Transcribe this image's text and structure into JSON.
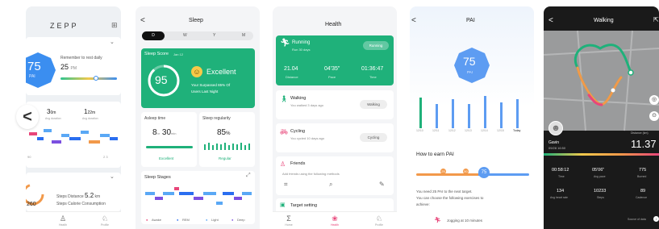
{
  "p1": {
    "logo": "ZEPP",
    "pai_value": "75",
    "pai_unit": "PAI",
    "remind_text": "Remember to rest daily",
    "rest_value": "25",
    "rest_unit": "PM",
    "back_arrow": "<",
    "time_a": "3",
    "time_a_unit": "0m",
    "time_a_label": "Avg duration",
    "time_b": "1",
    "time_b_unit": "22m",
    "time_b_label": "Avg duration",
    "day_label": "90",
    "day_label2": "2 3",
    "steps_value": "260",
    "distance_label": "Steps Distance",
    "distance_value": "5.2",
    "distance_unit": "km",
    "calories_label": "Steps Calorie Consumption",
    "tab1_label": "Health",
    "tab2_label": "Profile"
  },
  "p2": {
    "back": "<",
    "title": "Sleep",
    "tabs": [
      "D",
      "W",
      "Y",
      "M"
    ],
    "score_label": "Sleep Score",
    "score_date": "Jan 12",
    "score_value": "95",
    "score_word": "Excellent",
    "score_desc_1": "Your Surpassed 85% Of",
    "score_desc_2": "Users Last Night",
    "asleep_label": "Asleep time",
    "asleep_h": "8",
    "asleep_h_unit": "hr",
    "asleep_m": "30",
    "asleep_m_unit": "min",
    "asleep_status": "Excellent",
    "regularity_label": "Sleep regularity",
    "regularity_value": "85",
    "regularity_unit": "%",
    "regularity_status": "Regular",
    "stages_label": "Sleep Stages",
    "legend": [
      "Awake",
      "REM",
      "Light",
      "Deep"
    ],
    "colors": {
      "green": "#1fb17a",
      "awake": "#e8467a",
      "rem": "#2a6ef0",
      "light": "#5aa8f5",
      "deep": "#7b4fe0"
    }
  },
  "p3": {
    "title": "Health",
    "running_label": "Running",
    "running_sub": "Run 30 days",
    "running_btn": "Running",
    "run_stat_1": "21.04",
    "run_stat_1_label": "Distance",
    "run_stat_2": "04'35\"",
    "run_stat_2_label": "Pace",
    "run_stat_3": "01:36:47",
    "run_stat_3_label": "Time",
    "walking_label": "Walking",
    "walking_sub": "You walked 3 days ago",
    "walking_btn": "Walking",
    "cycling_label": "Cycling",
    "cycling_sub": "You cycled 10 days ago",
    "cycling_btn": "Cycling",
    "friends_label": "Friends",
    "friends_sub": "Add friends using the following methods",
    "target_label": "Target setting",
    "tab1_label": "Home",
    "tab2_label": "Health",
    "tab3_label": "Profile"
  },
  "p4": {
    "back": "<",
    "title": "PAI",
    "pai_value": "75",
    "pai_unit": "PAI",
    "today_label": "Today",
    "bar_labels": [
      "12/10",
      "12/11",
      "12/12",
      "12/13",
      "12/14",
      "12/15",
      "Today"
    ],
    "how_label": "How to earn PAI",
    "scale_1": "25",
    "scale_2": "50",
    "scale_3": "75",
    "earn_text_1": "You need 25 PAI to the next target.",
    "earn_text_2": "You can choose the following exercises to",
    "earn_text_3": "achieve:",
    "jogging_text": "Jogging at 10 minutes"
  },
  "p5": {
    "back": "<",
    "title": "Walking",
    "share": "⇱",
    "user_name": "Gavin",
    "user_date": "09/28 16:50",
    "distance_value": "11.37",
    "distance_label": "Distance (km)",
    "stats": [
      {
        "value": "00:58:12",
        "label": "Time"
      },
      {
        "value": "05'06\"",
        "label": "Avg pace"
      },
      {
        "value": "775",
        "label": "Burned"
      },
      {
        "value": "134",
        "label": "Avg heart rate"
      },
      {
        "value": "10233",
        "label": "Steps"
      },
      {
        "value": "89",
        "label": "Cadence"
      }
    ],
    "source_label": "Source of data"
  }
}
